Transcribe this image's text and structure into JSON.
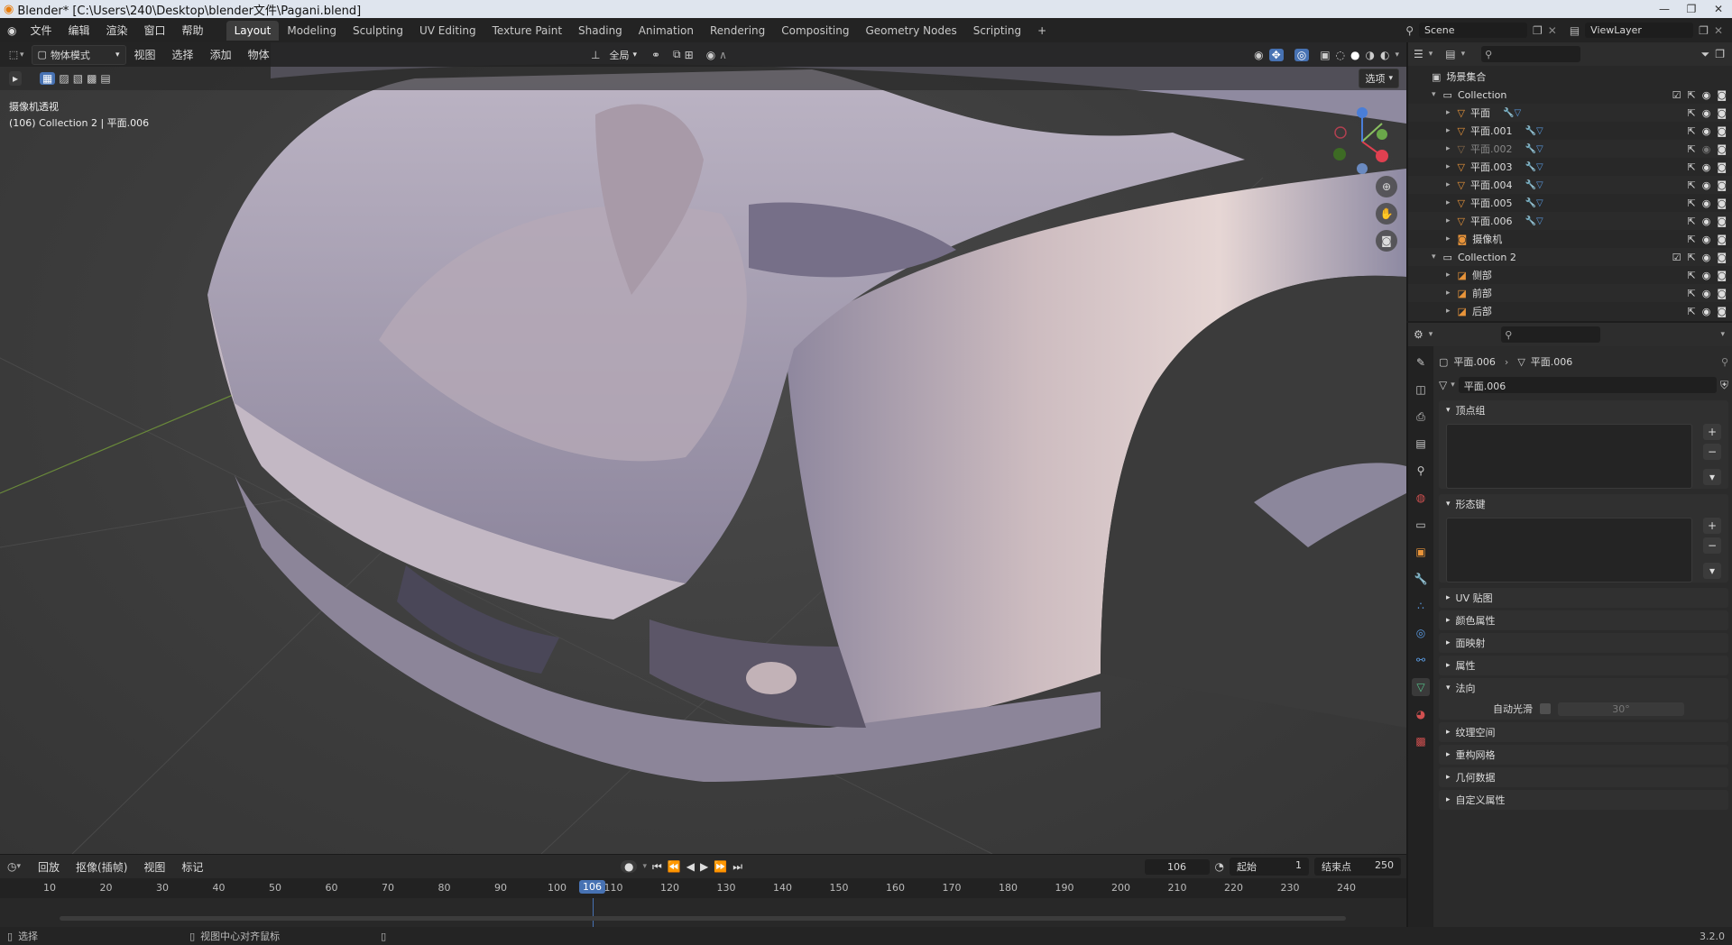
{
  "window": {
    "title": "Blender* [C:\\Users\\240\\Desktop\\blender文件\\Pagani.blend]"
  },
  "menu": {
    "items": [
      "文件",
      "编辑",
      "渲染",
      "窗口",
      "帮助"
    ]
  },
  "workspaces": {
    "tabs": [
      "Layout",
      "Modeling",
      "Sculpting",
      "UV Editing",
      "Texture Paint",
      "Shading",
      "Animation",
      "Rendering",
      "Compositing",
      "Geometry Nodes",
      "Scripting"
    ],
    "active": "Layout",
    "add_label": "+"
  },
  "scene": {
    "name": "Scene",
    "view_layer": "ViewLayer"
  },
  "viewport": {
    "mode": "物体模式",
    "menus": [
      "视图",
      "选择",
      "添加",
      "物体"
    ],
    "orientation": "全局",
    "options_label": "选项",
    "overlay_title": "摄像机透视",
    "overlay_subtitle": "(106) Collection 2 | 平面.006"
  },
  "outliner": {
    "root": "场景集合",
    "rows": [
      {
        "label": "Collection",
        "type": "collection"
      },
      {
        "label": "平面",
        "type": "mesh"
      },
      {
        "label": "平面.001",
        "type": "mesh"
      },
      {
        "label": "平面.002",
        "type": "mesh",
        "dim": true
      },
      {
        "label": "平面.003",
        "type": "mesh"
      },
      {
        "label": "平面.004",
        "type": "mesh"
      },
      {
        "label": "平面.005",
        "type": "mesh"
      },
      {
        "label": "平面.006",
        "type": "mesh"
      },
      {
        "label": "摄像机",
        "type": "camera"
      },
      {
        "label": "Collection 2",
        "type": "collection"
      },
      {
        "label": "侧部",
        "type": "image"
      },
      {
        "label": "前部",
        "type": "image"
      },
      {
        "label": "后部",
        "type": "image"
      }
    ]
  },
  "properties": {
    "breadcrumb_object": "平面.006",
    "breadcrumb_data": "平面.006",
    "data_name": "平面.006",
    "panels": {
      "vertex_groups": "顶点组",
      "shape_keys": "形态键",
      "uv_maps": "UV 贴图",
      "color_attributes": "颜色属性",
      "face_maps": "面映射",
      "attributes": "属性",
      "normals": "法向",
      "auto_smooth": "自动光滑",
      "auto_smooth_angle": "30°",
      "texture_space": "纹理空间",
      "remesh": "重构网格",
      "geometry_data": "几何数据",
      "custom_props": "自定义属性"
    }
  },
  "timeline": {
    "menus": [
      "回放",
      "抠像(插帧)",
      "视图",
      "标记"
    ],
    "current_frame": "106",
    "start_label": "起始",
    "start": "1",
    "end_label": "结束点",
    "end": "250",
    "ticks": [
      "10",
      "20",
      "30",
      "40",
      "50",
      "60",
      "70",
      "80",
      "90",
      "100",
      "110",
      "120",
      "130",
      "140",
      "150",
      "160",
      "170",
      "180",
      "190",
      "200",
      "210",
      "220",
      "230",
      "240"
    ]
  },
  "status": {
    "select": "选择",
    "center_view": "视图中心对齐鼠标",
    "version": "3.2.0"
  }
}
